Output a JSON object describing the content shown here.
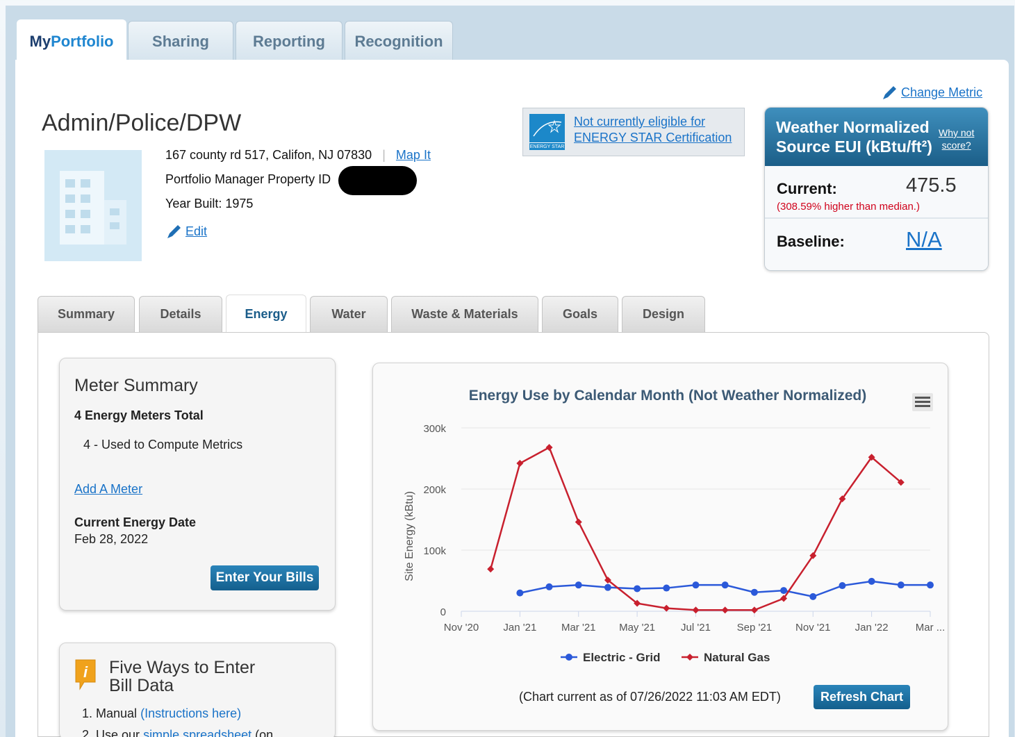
{
  "top_tabs": [
    {
      "label_my": "My",
      "label_rest": "Portfolio"
    },
    {
      "label": "Sharing"
    },
    {
      "label": "Reporting"
    },
    {
      "label": "Recognition"
    }
  ],
  "property": {
    "name": "Admin/Police/DPW",
    "address": "167 county rd 517, Califon, NJ 07830",
    "map_link": "Map It",
    "pm_id_label": "Portfolio Manager Property ID",
    "year_built": "Year Built: 1975",
    "edit_link": "Edit"
  },
  "energy_star": {
    "logo_text": "ENERGY STAR",
    "link_line1": "Not currently eligible for",
    "link_line2": "ENERGY STAR Certification"
  },
  "metric": {
    "change_link": "Change Metric",
    "title_line1": "Weather Normalized",
    "title_line2": "Source EUI (kBtu/ft²)",
    "why_line1": "Why not",
    "why_line2": "score?",
    "current_label": "Current:",
    "current_value": "475.5",
    "current_note": "(308.59% higher than median.)",
    "baseline_label": "Baseline:",
    "baseline_value": "N/A",
    "note_color": "#d0021b"
  },
  "sub_tabs": [
    "Summary",
    "Details",
    "Energy",
    "Water",
    "Waste & Materials",
    "Goals",
    "Design"
  ],
  "meter_summary": {
    "title": "Meter Summary",
    "total": "4 Energy Meters Total",
    "used": "4 - Used to Compute Metrics",
    "add_link": "Add A Meter",
    "date_label": "Current Energy Date",
    "date_value": "Feb 28, 2022",
    "enter_bills": "Enter Your Bills"
  },
  "five_ways": {
    "title_line1": "Five Ways to Enter",
    "title_line2": "Bill Data",
    "item1_text": "1. Manual",
    "item1_link": "(Instructions here)",
    "item2_text": "2. Use our",
    "item2_link": "simple spreadsheet",
    "item2_rest": "(on"
  },
  "chart_footer": {
    "current_as_of": "(Chart current as of  07/26/2022 11:03 AM EDT)",
    "refresh": "Refresh Chart"
  },
  "chart_data": {
    "type": "line",
    "title": "Energy Use by Calendar Month (Not Weather Normalized)",
    "ylabel": "Site Energy (kBtu)",
    "ylim": [
      0,
      300000
    ],
    "yticks": [
      "0",
      "100k",
      "200k",
      "300k"
    ],
    "xtick_labels": [
      "Nov '20",
      "Jan '21",
      "Mar '21",
      "May '21",
      "Jul '21",
      "Sep '21",
      "Nov '21",
      "Jan '22",
      "Mar ..."
    ],
    "x": [
      "Dec '20",
      "Jan '21",
      "Feb '21",
      "Mar '21",
      "Apr '21",
      "May '21",
      "Jun '21",
      "Jul '21",
      "Aug '21",
      "Sep '21",
      "Oct '21",
      "Nov '21",
      "Dec '21",
      "Jan '22",
      "Feb '22",
      "Mar '22"
    ],
    "series": [
      {
        "name": "Electric - Grid",
        "color": "#2b59d9",
        "marker": "circle",
        "values": [
          null,
          30000,
          40000,
          43000,
          39000,
          37000,
          38000,
          43000,
          43000,
          31000,
          34000,
          24000,
          42000,
          49000,
          43000,
          43000
        ]
      },
      {
        "name": "Natural Gas",
        "color": "#c8202e",
        "marker": "diamond",
        "values": [
          69000,
          242000,
          268000,
          146000,
          51000,
          13000,
          5000,
          2000,
          2000,
          2000,
          21000,
          91000,
          184000,
          252000,
          211000,
          null
        ]
      }
    ],
    "legend_position": "bottom"
  }
}
